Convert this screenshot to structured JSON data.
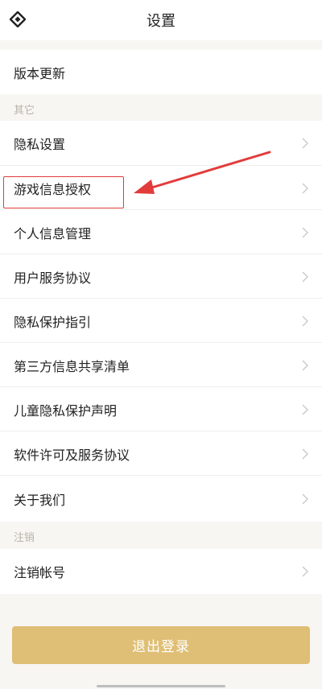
{
  "header": {
    "title": "设置",
    "logo_icon": "diamond-logo-icon"
  },
  "top_section": {
    "version_label": "版本更新"
  },
  "sections": {
    "other": "其它",
    "logout_section": "注销"
  },
  "other_items": [
    "隐私设置",
    "游戏信息授权",
    "个人信息管理",
    "用户服务协议",
    "隐私保护指引",
    "第三方信息共享清单",
    "儿童隐私保护声明",
    "软件许可及服务协议",
    "关于我们"
  ],
  "logout_items": [
    "注销帐号"
  ],
  "buttons": {
    "logout": "退出登录"
  },
  "colors": {
    "accent": "#dfbf75",
    "highlight": "#e23b3b",
    "section_text": "#b8b3a8"
  }
}
